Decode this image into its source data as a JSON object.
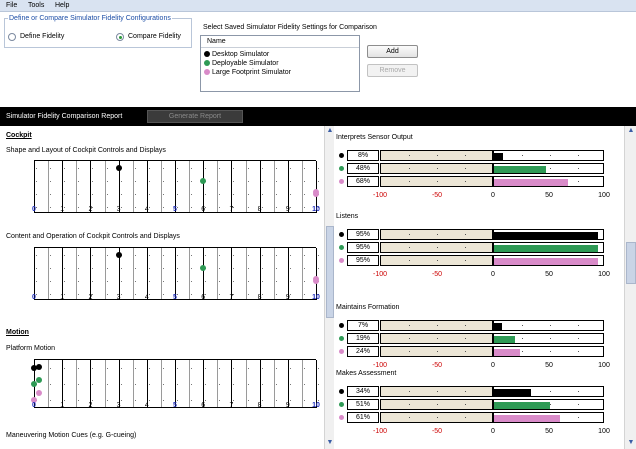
{
  "menu": {
    "items": [
      "File",
      "Tools",
      "Help"
    ]
  },
  "fidelity_group": {
    "title": "Define or Compare Simulator Fidelity Configurations",
    "define_label": "Define Fidelity",
    "compare_label": "Compare Fidelity",
    "selected": "compare"
  },
  "saved_settings": {
    "label": "Select Saved Simulator Fidelity Settings for Comparison",
    "column_header": "Name",
    "items": [
      {
        "name": "Desktop Simulator",
        "color": "#000000"
      },
      {
        "name": "Deployable Simulator",
        "color": "#2e9a55"
      },
      {
        "name": "Large Footprint Simulator",
        "color": "#d98bc9"
      }
    ],
    "add_label": "Add",
    "remove_label": "Remove"
  },
  "report_bar": {
    "title": "Simulator Fidelity Comparison Report",
    "generate_label": "Generate Report"
  },
  "left_panel": {
    "sections": [
      {
        "title": "Cockpit",
        "items": [
          {
            "label": "Shape and Layout of Cockpit Controls and Displays",
            "values": [
              3,
              6,
              10
            ]
          },
          {
            "label": "Content and Operation of Cockpit Controls and Displays",
            "values": [
              3,
              6,
              10
            ]
          }
        ]
      },
      {
        "title": "Motion",
        "items": [
          {
            "label": "Platform Motion",
            "values": [
              0,
              0,
              0
            ]
          },
          {
            "label": "Maneuvering Motion Cues (e.g. G-cueing)",
            "values": []
          }
        ]
      }
    ],
    "tick_labels": [
      "0",
      "1",
      "2",
      "3",
      "4",
      "5",
      "6",
      "7",
      "8",
      "9",
      "10"
    ]
  },
  "right_panel": {
    "axis_labels": [
      "-100",
      "-50",
      "0",
      "50",
      "100"
    ],
    "metrics": [
      {
        "title": "Interprets Sensor Output",
        "rows": [
          {
            "pct": "8%",
            "value": 8
          },
          {
            "pct": "48%",
            "value": 48
          },
          {
            "pct": "68%",
            "value": 68
          }
        ]
      },
      {
        "title": "Listens",
        "rows": [
          {
            "pct": "95%",
            "value": 95
          },
          {
            "pct": "95%",
            "value": 95
          },
          {
            "pct": "95%",
            "value": 95
          }
        ]
      },
      {
        "title": "Maintains Formation",
        "rows": [
          {
            "pct": "7%",
            "value": 7
          },
          {
            "pct": "19%",
            "value": 19
          },
          {
            "pct": "24%",
            "value": 24
          }
        ]
      },
      {
        "title": "Makes Assessment",
        "rows": [
          {
            "pct": "34%",
            "value": 34
          },
          {
            "pct": "51%",
            "value": 51
          },
          {
            "pct": "61%",
            "value": 61
          }
        ]
      }
    ]
  },
  "colors": {
    "desktop": "#000000",
    "deployable": "#2e9a55",
    "large": "#d98bc9"
  }
}
